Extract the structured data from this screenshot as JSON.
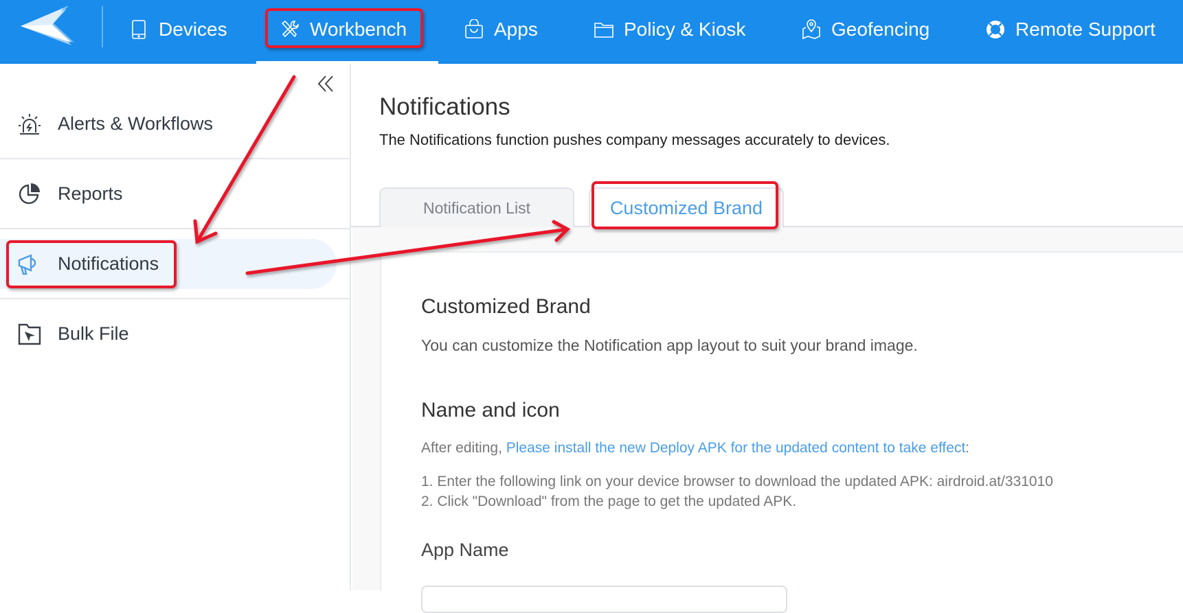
{
  "topnav": {
    "logo": "airdroid-plane-logo",
    "items": [
      {
        "label": "Devices",
        "icon": "tablet-icon"
      },
      {
        "label": "Workbench",
        "icon": "tools-icon",
        "active": true
      },
      {
        "label": "Apps",
        "icon": "shopping-bag-icon"
      },
      {
        "label": "Policy & Kiosk",
        "icon": "folder-icon"
      },
      {
        "label": "Geofencing",
        "icon": "map-pin-icon"
      },
      {
        "label": "Remote Support",
        "icon": "lifebuoy-icon"
      }
    ]
  },
  "sidebar": {
    "collapse_label": "«",
    "items": [
      {
        "label": "Alerts & Workflows",
        "icon": "siren-icon"
      },
      {
        "label": "Reports",
        "icon": "pie-chart-icon"
      },
      {
        "label": "Notifications",
        "icon": "megaphone-icon",
        "active": true
      },
      {
        "label": "Bulk File",
        "icon": "folder-send-icon"
      }
    ]
  },
  "main": {
    "title": "Notifications",
    "description": "The Notifications function pushes company messages accurately to devices.",
    "tabs": [
      {
        "label": "Notification List"
      },
      {
        "label": "Customized Brand",
        "active": true
      }
    ],
    "content": {
      "brand_title": "Customized Brand",
      "brand_desc": "You can customize the Notification app layout to suit your brand image.",
      "name_icon_title": "Name and icon",
      "note_prefix": "After editing, ",
      "note_link": "Please install the new Deploy APK for the updated content to take effect",
      "note_suffix": ":",
      "steps": [
        "1. Enter the following link on your device browser to download the updated APK: airdroid.at/331010",
        "2. Click \"Download\" from the page to get the updated APK."
      ],
      "app_name_label": "App Name",
      "app_name_value": ""
    }
  },
  "colors": {
    "brand": "#1a8ceb",
    "accent_link": "#4b9de6",
    "annotation": "#e8192c",
    "active_sidebar_bg": "#eff5fd"
  }
}
